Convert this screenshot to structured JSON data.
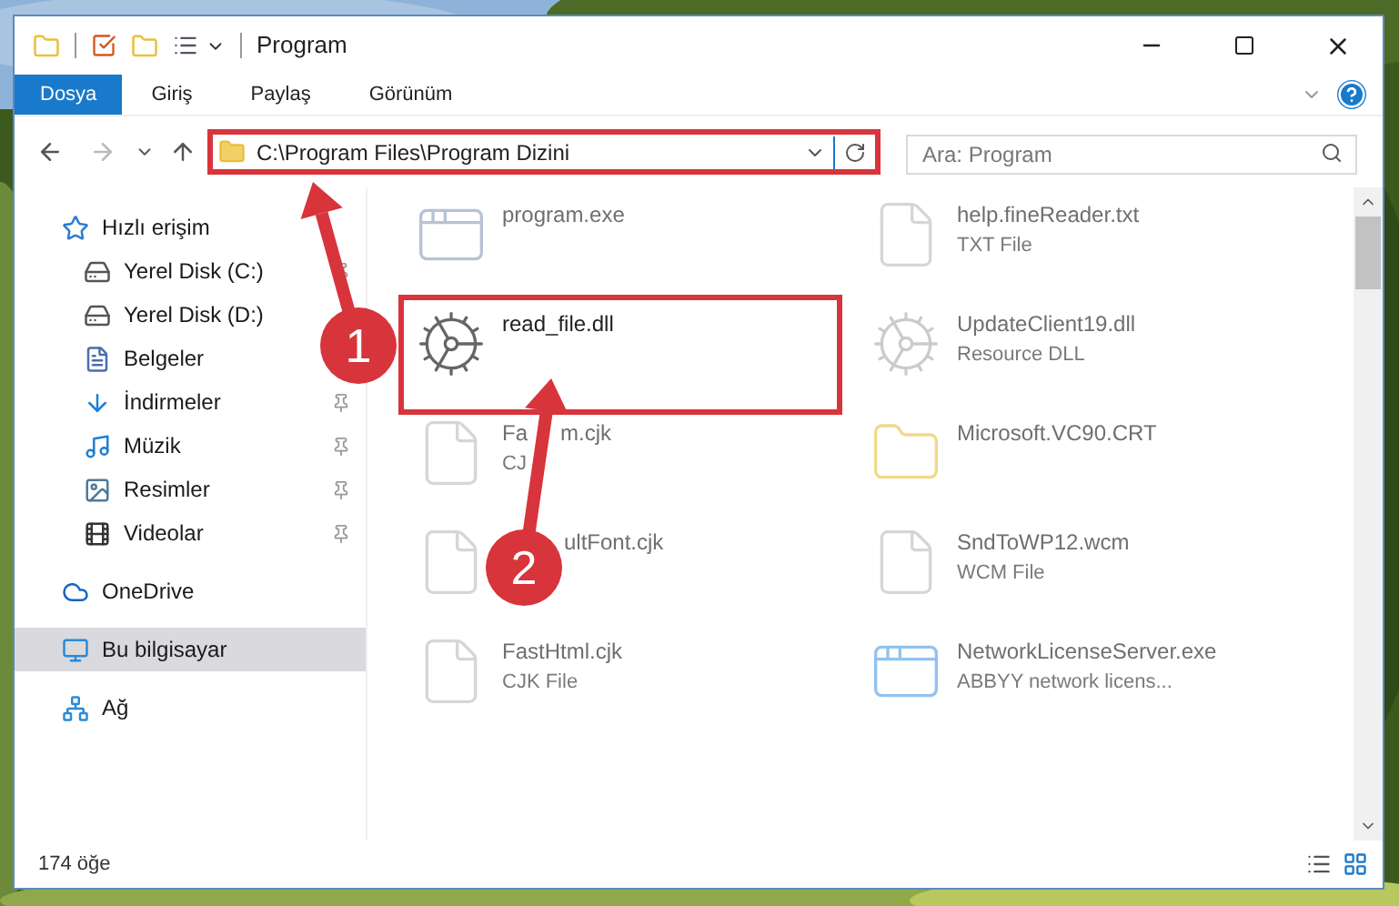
{
  "window": {
    "title": "Program"
  },
  "ribbon_tabs": [
    {
      "label": "Dosya",
      "selected": true
    },
    {
      "label": "Giriş",
      "selected": false
    },
    {
      "label": "Paylaş",
      "selected": false
    },
    {
      "label": "Görünüm",
      "selected": false
    }
  ],
  "address": {
    "path": "C:\\Program Files\\Program Dizini",
    "highlighted": true
  },
  "search": {
    "placeholder": "Ara: Program"
  },
  "sidebar": {
    "items": [
      {
        "label": "Hızlı erişim",
        "kind": "section",
        "pinned": false,
        "selected": false
      },
      {
        "label": "Yerel Disk (C:)",
        "kind": "item",
        "pinned": true,
        "selected": false
      },
      {
        "label": "Yerel Disk (D:)",
        "kind": "item",
        "pinned": false,
        "selected": false
      },
      {
        "label": "Belgeler",
        "kind": "item",
        "pinned": false,
        "selected": false
      },
      {
        "label": "İndirmeler",
        "kind": "item",
        "pinned": true,
        "selected": false
      },
      {
        "label": "Müzik",
        "kind": "item",
        "pinned": true,
        "selected": false
      },
      {
        "label": "Resimler",
        "kind": "item",
        "pinned": true,
        "selected": false
      },
      {
        "label": "Videolar",
        "kind": "item",
        "pinned": true,
        "selected": false
      },
      {
        "label": "OneDrive",
        "kind": "section",
        "pinned": false,
        "selected": false
      },
      {
        "label": "Bu bilgisayar",
        "kind": "section",
        "pinned": false,
        "selected": true
      },
      {
        "label": "Ağ",
        "kind": "section",
        "pinned": false,
        "selected": false
      }
    ]
  },
  "files": [
    {
      "name_parts": [
        "program.exe"
      ],
      "dimmed": true,
      "highlighted": false
    },
    {
      "name_parts": [
        "help.fineReader.txt"
      ],
      "type": "TXT File",
      "dimmed": true,
      "highlighted": false
    },
    {
      "name_parts": [
        "read_file.dll"
      ],
      "dimmed": false,
      "highlighted": true
    },
    {
      "name_parts": [
        "UpdateClient19.dll"
      ],
      "type": "Resource DLL",
      "dimmed": true,
      "highlighted": false
    },
    {
      "name_parts": [
        "Fa",
        "m.cjk"
      ],
      "type": "CJ",
      "dimmed": true,
      "highlighted": false
    },
    {
      "name_parts": [
        "Microsoft.VC90.CRT"
      ],
      "dimmed": true,
      "highlighted": false
    },
    {
      "name_parts": [
        "ultFont.cjk"
      ],
      "dimmed": true,
      "highlighted": false
    },
    {
      "name_parts": [
        "SndToWP12.wcm"
      ],
      "type": "WCM File",
      "dimmed": true,
      "highlighted": false
    },
    {
      "name_parts": [
        "FastHtml.cjk"
      ],
      "type": "CJK File",
      "dimmed": true,
      "highlighted": false
    },
    {
      "name_parts": [
        "NetworkLicenseServer.exe"
      ],
      "type": "ABBYY network licens...",
      "dimmed": true,
      "highlighted": false
    }
  ],
  "annotations": [
    {
      "number": "1"
    },
    {
      "number": "2"
    }
  ],
  "status_bar": {
    "count": "174 öğe"
  }
}
